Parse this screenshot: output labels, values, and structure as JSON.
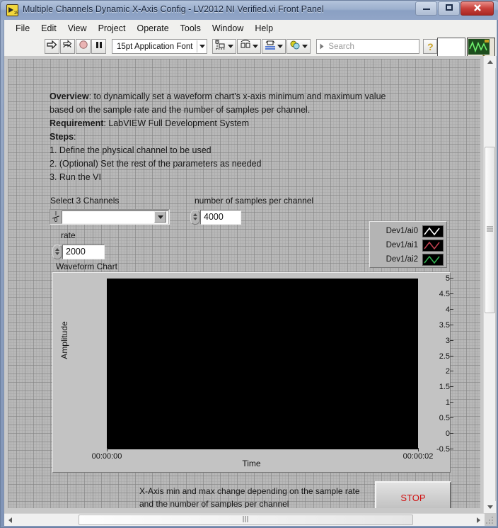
{
  "window": {
    "title": "Multiple Channels Dynamic X-Axis Config - LV2012 NI Verified.vi Front Panel",
    "minimize_label": "—",
    "maximize_label": "❐",
    "close_label": "✕",
    "app_icon": "labview-vi-icon"
  },
  "menu": {
    "items": [
      {
        "label": "File"
      },
      {
        "label": "Edit"
      },
      {
        "label": "View"
      },
      {
        "label": "Project"
      },
      {
        "label": "Operate"
      },
      {
        "label": "Tools"
      },
      {
        "label": "Window"
      },
      {
        "label": "Help"
      }
    ]
  },
  "toolbar": {
    "run_icon": "run-arrow-icon",
    "run_continuously_icon": "run-continuously-icon",
    "abort_icon": "abort-execution-icon",
    "pause_icon": "pause-icon",
    "font_selector": "15pt Application Font",
    "align_icon": "align-objects-icon",
    "distribute_icon": "distribute-objects-icon",
    "resize_icon": "resize-objects-icon",
    "reorder_icon": "reorder-objects-icon",
    "search_placeholder": "Search",
    "search_value": "",
    "search_icon": "magnifier-icon",
    "help_icon": "context-help-icon",
    "vi_icon_badge": "2"
  },
  "panel": {
    "description": {
      "lines": [
        {
          "bold": "Overview",
          "text": ": to dynamically set a waveform chart's x-axis minimum and maximum value"
        },
        {
          "bold": "",
          "text": "based on the sample rate and the number of samples per channel."
        },
        {
          "bold": "Requirement",
          "text": ": LabVIEW Full Development System"
        },
        {
          "bold": "Steps",
          "text": ":"
        },
        {
          "bold": "",
          "text": "1. Define the physical channel to be used"
        },
        {
          "bold": "",
          "text": "2. (Optional) Set the rest of the parameters as needed"
        },
        {
          "bold": "",
          "text": "3. Run the VI"
        }
      ]
    },
    "controls": {
      "channels_label": "Select 3 Channels",
      "channels_value": "",
      "channels_glyph": "I/O",
      "samples_label": "number of samples per channel",
      "samples_value": "4000",
      "rate_label": "rate",
      "rate_value": "2000"
    },
    "legend": {
      "rows": [
        {
          "name": "Dev1/ai0",
          "color": "#ffffff"
        },
        {
          "name": "Dev1/ai1",
          "color": "#c04050"
        },
        {
          "name": "Dev1/ai2",
          "color": "#30b050"
        }
      ]
    },
    "chart": {
      "label": "Waveform Chart",
      "plot_background": "#000000"
    },
    "footnote_line1": "X-Axis min and max change depending on the sample rate",
    "footnote_line2": "and the number of samples per channel",
    "stop_label": "STOP",
    "stop_color": "#d01010"
  },
  "chart_data": {
    "type": "line",
    "title": "Waveform Chart",
    "xlabel": "Time",
    "ylabel": "Amplitude",
    "grid": false,
    "legend_position": "outside-top-right",
    "ylim": [
      -0.5,
      5
    ],
    "ytick_labels": [
      "5",
      "4.5",
      "4",
      "3.5",
      "3",
      "2.5",
      "2",
      "1.5",
      "1",
      "0.5",
      "0",
      "-0.5"
    ],
    "ytick_values": [
      5,
      4.5,
      4,
      3.5,
      3,
      2.5,
      2,
      1.5,
      1,
      0.5,
      0,
      -0.5
    ],
    "xlim": [
      0,
      2
    ],
    "xtick_labels": [
      "00:00:00",
      "00:00:02"
    ],
    "xtick_values": [
      0,
      2
    ],
    "series": [
      {
        "name": "Dev1/ai0",
        "color": "#ffffff",
        "values": []
      },
      {
        "name": "Dev1/ai1",
        "color": "#c04050",
        "values": []
      },
      {
        "name": "Dev1/ai2",
        "color": "#30b050",
        "values": []
      }
    ]
  },
  "scrollbars": {
    "vertical_up": "scroll-up-arrow",
    "vertical_down": "scroll-down-arrow",
    "horizontal_left": "scroll-left-arrow",
    "horizontal_right": "scroll-right-arrow",
    "thumb_grip": "⦀"
  }
}
